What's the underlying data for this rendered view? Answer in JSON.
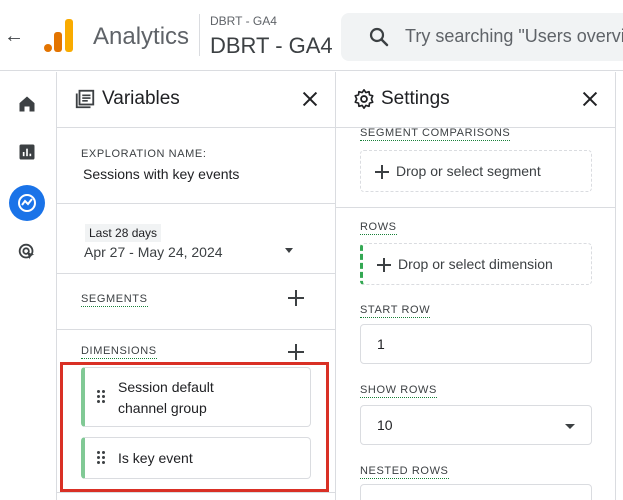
{
  "topbar": {
    "back_icon": "arrow-back-icon",
    "app_name": "Analytics",
    "account_small": "DBRT - GA4",
    "account_big": "DBRT - GA4",
    "search_placeholder": "Try searching \"Users overview\""
  },
  "leftnav": {
    "items": [
      {
        "icon": "home-icon"
      },
      {
        "icon": "reports-icon"
      },
      {
        "icon": "explore-icon",
        "active": true
      },
      {
        "icon": "advertising-icon"
      }
    ]
  },
  "variables": {
    "title": "Variables",
    "exploration_label": "EXPLORATION NAME:",
    "exploration_name": "Sessions with key events",
    "date_tag": "Last 28 days",
    "date_range": "Apr 27 - May 24, 2024",
    "segments_label": "SEGMENTS",
    "dimensions_label": "DIMENSIONS",
    "dimensions": [
      {
        "label_line1": "Session default",
        "label_line2": "channel group"
      },
      {
        "label_line1": "Is key event",
        "label_line2": ""
      }
    ]
  },
  "settings": {
    "title": "Settings",
    "segment_comparisons_label": "SEGMENT COMPARISONS",
    "segment_drop": "Drop or select segment",
    "rows_label": "ROWS",
    "rows_drop": "Drop or select dimension",
    "start_row_label": "START ROW",
    "start_row_value": "1",
    "show_rows_label": "SHOW ROWS",
    "show_rows_value": "10",
    "nested_rows_label": "NESTED ROWS"
  },
  "colors": {
    "accent_blue": "#1a73e8",
    "highlight_red": "#d93025",
    "dimension_green": "#81c995",
    "logo_orange": "#e37400",
    "logo_yellow": "#f9ab00"
  }
}
